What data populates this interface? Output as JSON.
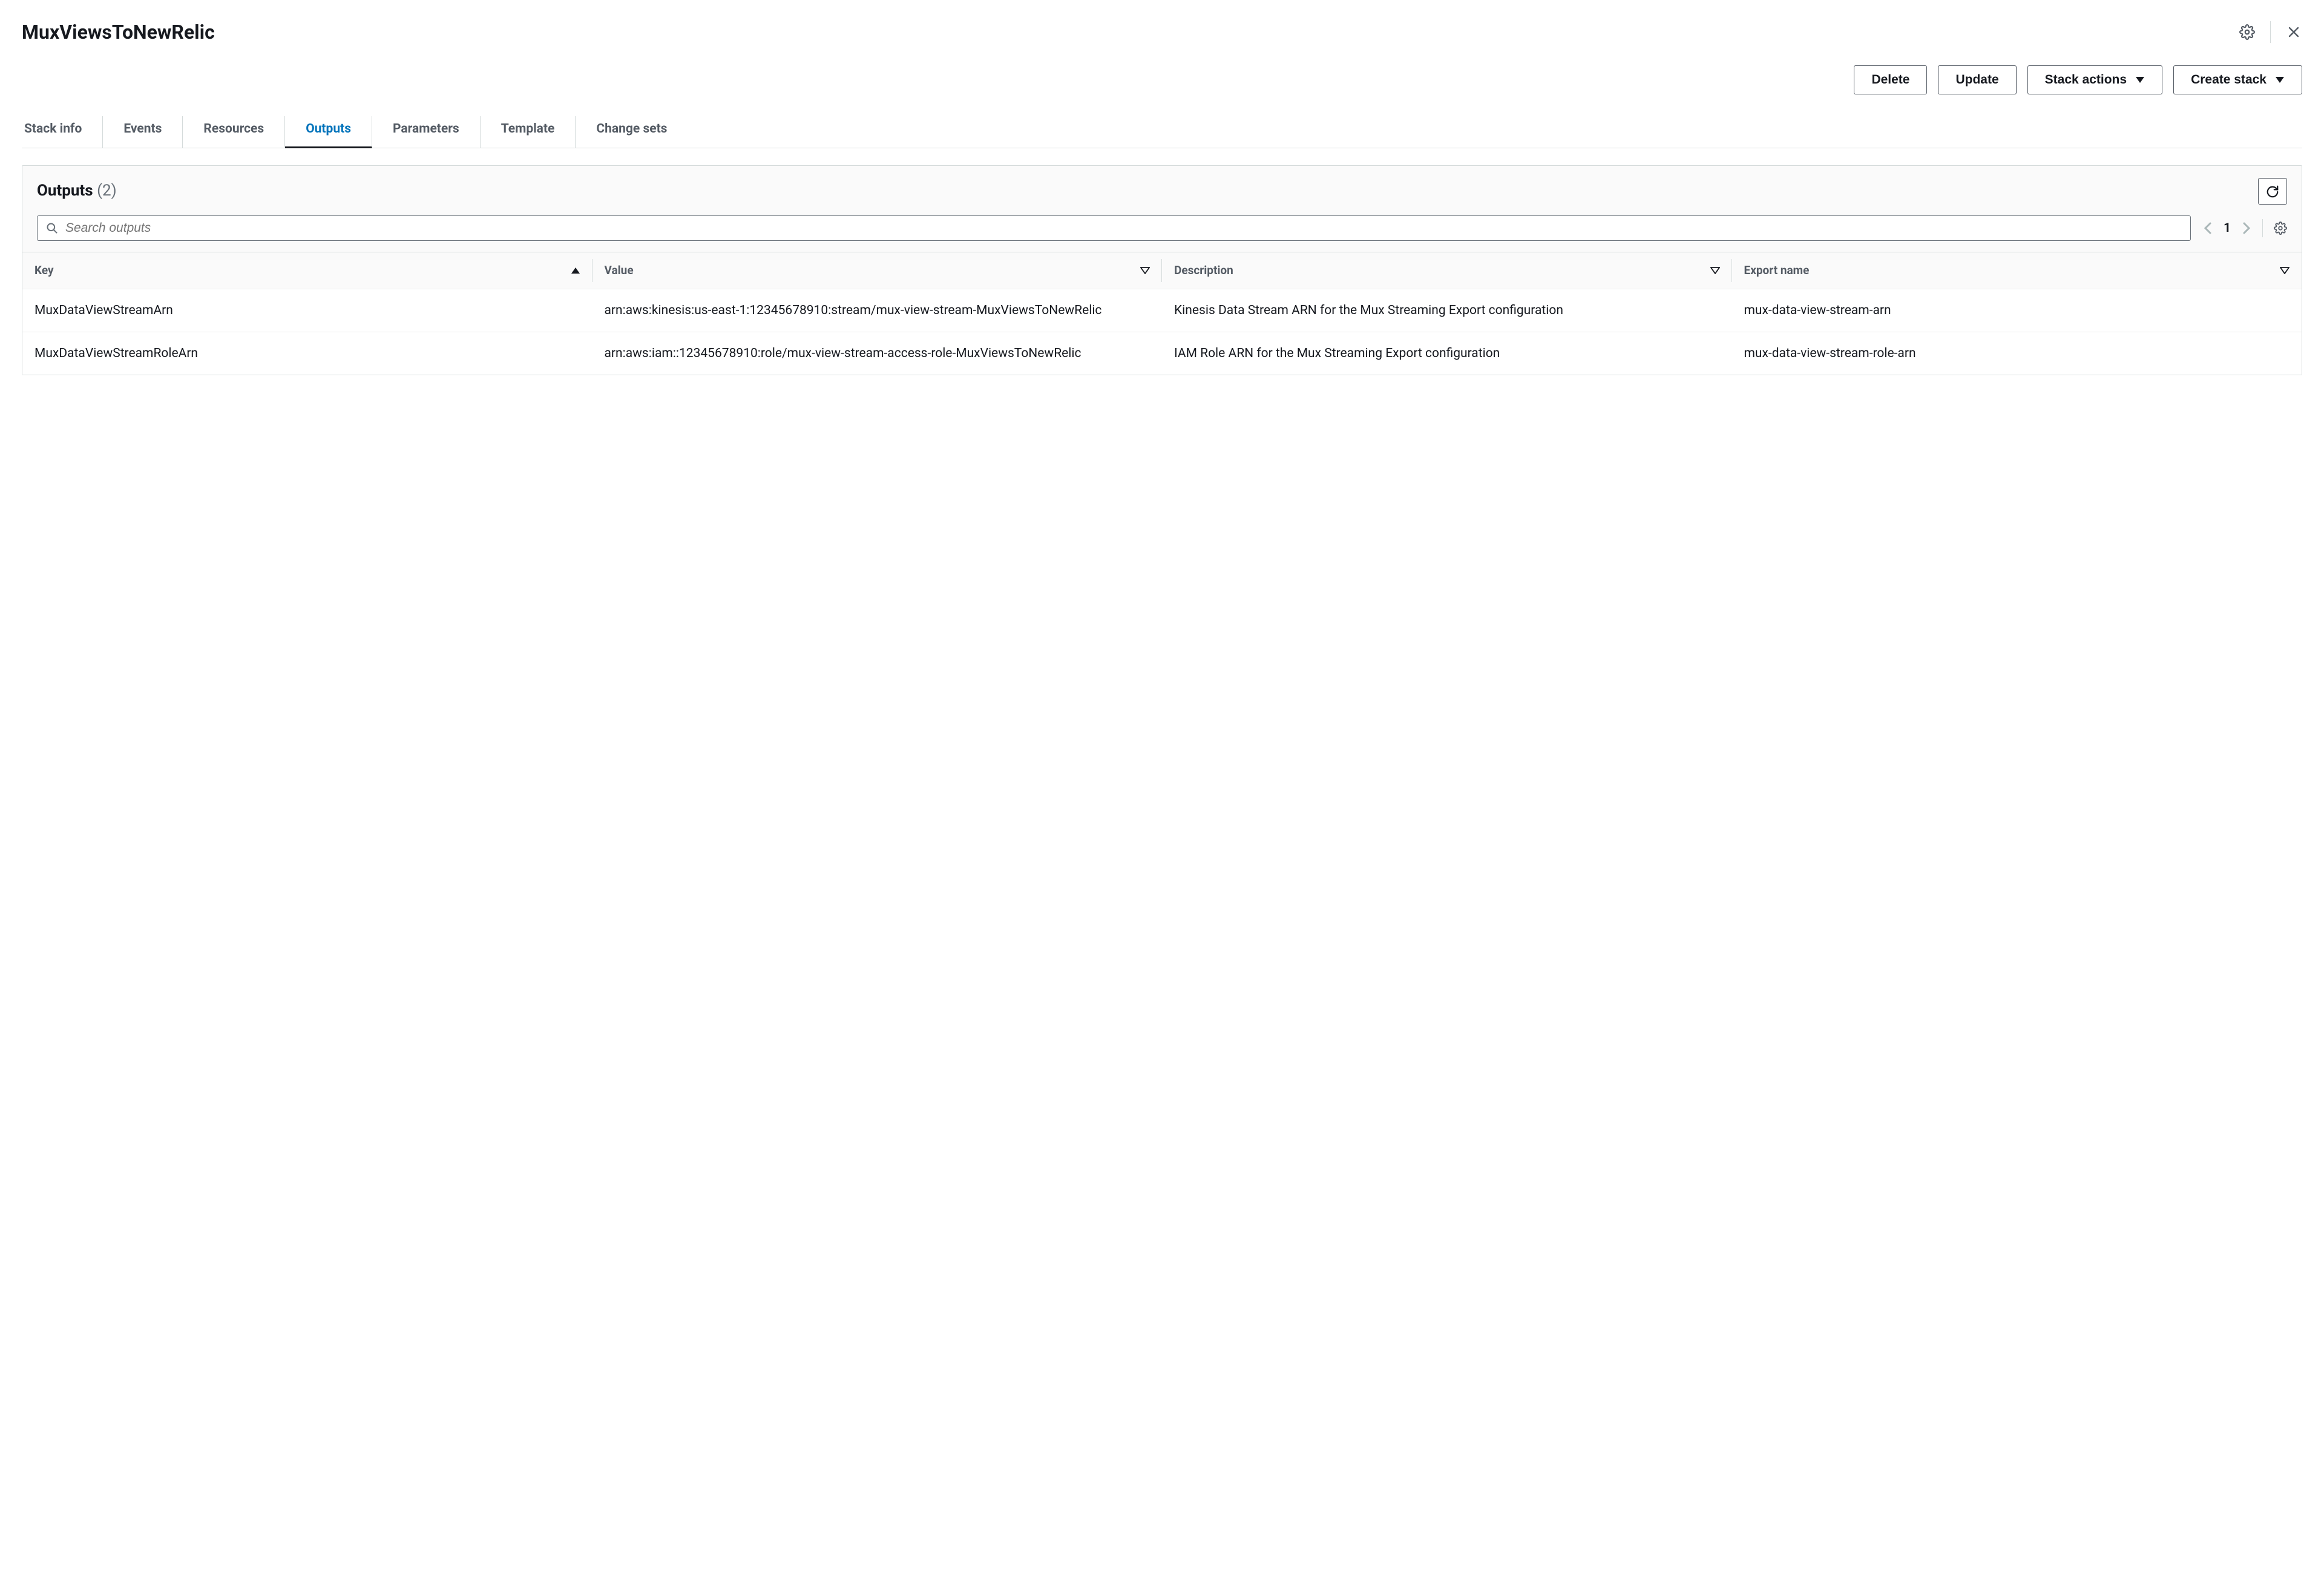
{
  "header": {
    "title": "MuxViewsToNewRelic"
  },
  "actions": {
    "delete": "Delete",
    "update": "Update",
    "stack_actions": "Stack actions",
    "create_stack": "Create stack"
  },
  "tabs": [
    {
      "id": "stack-info",
      "label": "Stack info",
      "active": false
    },
    {
      "id": "events",
      "label": "Events",
      "active": false
    },
    {
      "id": "resources",
      "label": "Resources",
      "active": false
    },
    {
      "id": "outputs",
      "label": "Outputs",
      "active": true
    },
    {
      "id": "parameters",
      "label": "Parameters",
      "active": false
    },
    {
      "id": "template",
      "label": "Template",
      "active": false
    },
    {
      "id": "change-sets",
      "label": "Change sets",
      "active": false
    }
  ],
  "panel": {
    "title": "Outputs",
    "count": "(2)",
    "search_placeholder": "Search outputs",
    "page": "1"
  },
  "columns": {
    "key": "Key",
    "value": "Value",
    "description": "Description",
    "export_name": "Export name"
  },
  "rows": [
    {
      "key": "MuxDataViewStreamArn",
      "value": "arn:aws:kinesis:us-east-1:12345678910:stream/mux-view-stream-MuxViewsToNewRelic",
      "description": "Kinesis Data Stream ARN for the Mux Streaming Export configuration",
      "export_name": "mux-data-view-stream-arn"
    },
    {
      "key": "MuxDataViewStreamRoleArn",
      "value": "arn:aws:iam::12345678910:role/mux-view-stream-access-role-MuxViewsToNewRelic",
      "description": "IAM Role ARN for the Mux Streaming Export configuration",
      "export_name": "mux-data-view-stream-role-arn"
    }
  ]
}
